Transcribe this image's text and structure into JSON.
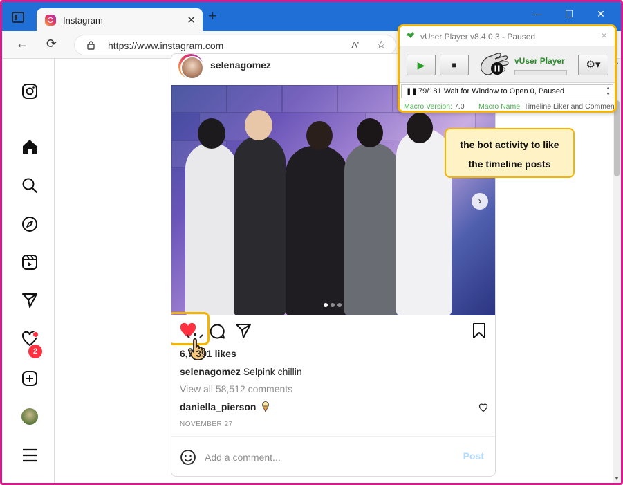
{
  "browser": {
    "tab_title": "Instagram",
    "tab_close": "✕",
    "new_tab": "+",
    "url": "https://www.instagram.com",
    "read_aloud": "A)",
    "window_controls": [
      "—",
      "☐",
      "✕"
    ]
  },
  "sidebar": {
    "items": [
      "instagram-logo",
      "home",
      "search",
      "explore",
      "reels",
      "messages",
      "notifications",
      "create",
      "profile",
      "more"
    ],
    "messages_badge": "2"
  },
  "post": {
    "username": "selenagomez",
    "likes": "6,7 391 likes",
    "caption_user": "selenagomez",
    "caption_text": "Selpink chillin",
    "view_comments": "View all 58,512 comments",
    "comment_user": "daniella_pierson",
    "date": "NOVEMBER 27",
    "comment_placeholder": "Add a comment...",
    "post_button": "Post",
    "liked": true,
    "carousel": {
      "count": 3,
      "active": 0
    }
  },
  "vuser": {
    "title": "vUser Player v8.4.0.3 - Paused",
    "brand": "vUser Player",
    "status": "79/181 Wait for Window to Open 0, Paused",
    "macro_version_label": "Macro Version:",
    "macro_version": "7.0",
    "macro_name_label": "Macro Name:",
    "macro_name": "Timeline Liker and Comment"
  },
  "callout": {
    "line1": "the bot activity to like",
    "line2": "the timeline posts"
  },
  "colors": {
    "frame_border": "#d81b8c",
    "browser_chrome": "#1f6fd6",
    "highlight": "#f4b400",
    "like_red": "#ff3040",
    "brand_green": "#2a8c2a"
  }
}
